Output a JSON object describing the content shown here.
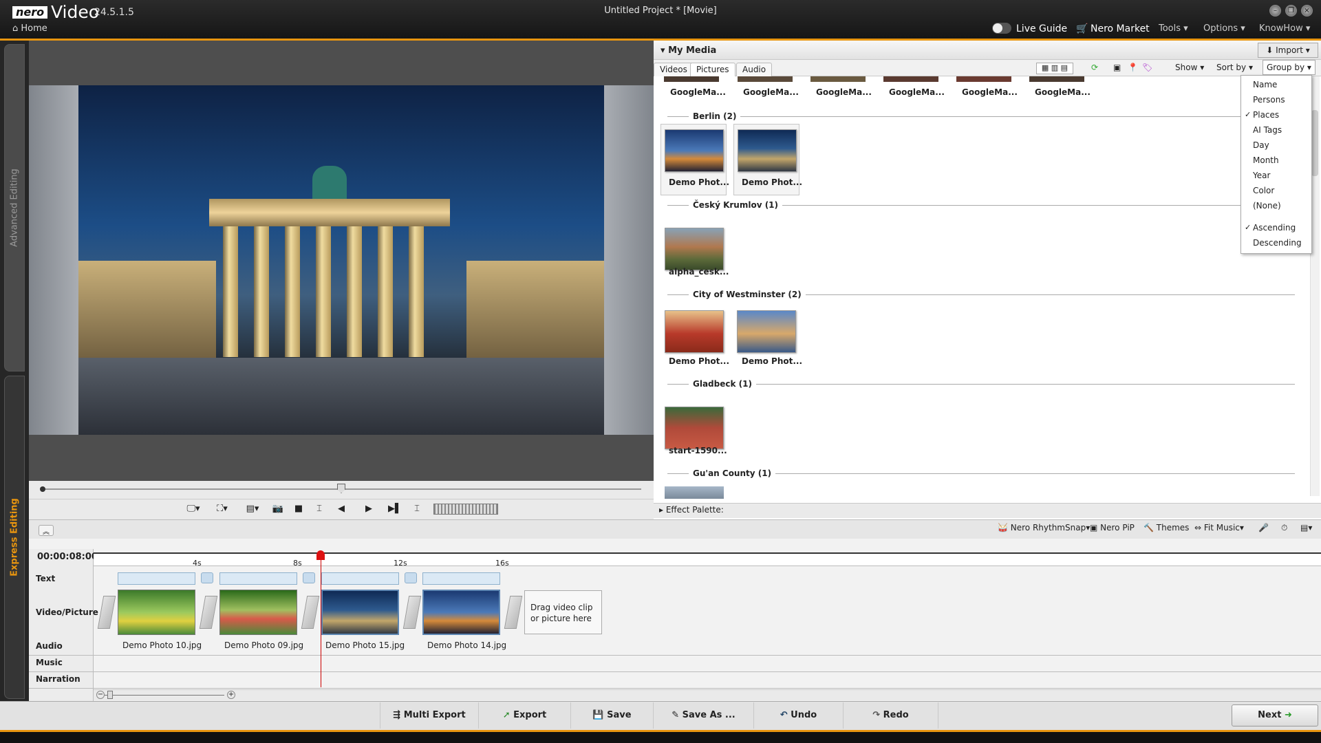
{
  "app": {
    "logo": "nero",
    "name": "Video",
    "version": "24.5.1.5",
    "window_title": "Untitled Project * [Movie]",
    "home": "Home"
  },
  "titlebar_menu": {
    "live_guide": "Live Guide",
    "nero_market": "Nero Market",
    "tools": "Tools",
    "options": "Options",
    "knowhow": "KnowHow"
  },
  "side_tabs": {
    "advanced": "Advanced Editing",
    "express": "Express Editing"
  },
  "media": {
    "title": "My Media",
    "import": "Import",
    "tabs": [
      "Videos",
      "Pictures",
      "Audio"
    ],
    "show": "Show",
    "sort_by": "Sort by",
    "group_by": "Group by",
    "top_row": [
      "GoogleMa...",
      "GoogleMa...",
      "GoogleMa...",
      "GoogleMa...",
      "GoogleMa...",
      "GoogleMa..."
    ],
    "groups": [
      {
        "title": "Berlin (2)",
        "items": [
          "Demo Phot...",
          "Demo Phot..."
        ]
      },
      {
        "title": "Český Krumlov (1)",
        "items": [
          "alpha_cesk..."
        ]
      },
      {
        "title": "City of Westminster (2)",
        "items": [
          "Demo Phot...",
          "Demo Phot..."
        ]
      },
      {
        "title": "Gladbeck (1)",
        "items": [
          "start-1590..."
        ]
      },
      {
        "title": "Gu'an County (1)",
        "items": []
      }
    ]
  },
  "group_menu": {
    "items": [
      "Name",
      "Persons",
      "Places",
      "AI Tags",
      "Day",
      "Month",
      "Year",
      "Color",
      "(None)"
    ],
    "checked": "Places",
    "order": [
      "Ascending",
      "Descending"
    ],
    "order_checked": "Ascending"
  },
  "effect_palette": "Effect Palette:",
  "timeline_tools": {
    "rhythm": "Nero RhythmSnap",
    "pip": "Nero PiP",
    "themes": "Themes",
    "fit": "Fit Music"
  },
  "timeline": {
    "timecode": "00:00:08:00",
    "ticks": [
      "4s",
      "8s",
      "12s",
      "16s"
    ],
    "tracks": [
      "Text",
      "Video/Picture",
      "Audio",
      "Music",
      "Narration"
    ],
    "clips": [
      "Demo Photo 10.jpg",
      "Demo Photo 09.jpg",
      "Demo Photo 15.jpg",
      "Demo Photo 14.jpg"
    ],
    "drop_hint": "Drag video clip or picture here"
  },
  "bottom": {
    "multi_export": "Multi Export",
    "export": "Export",
    "save": "Save",
    "save_as": "Save As ...",
    "undo": "Undo",
    "redo": "Redo",
    "next": "Next"
  },
  "colors": {
    "accent": "#e8950f",
    "playhead": "#cc0000"
  }
}
